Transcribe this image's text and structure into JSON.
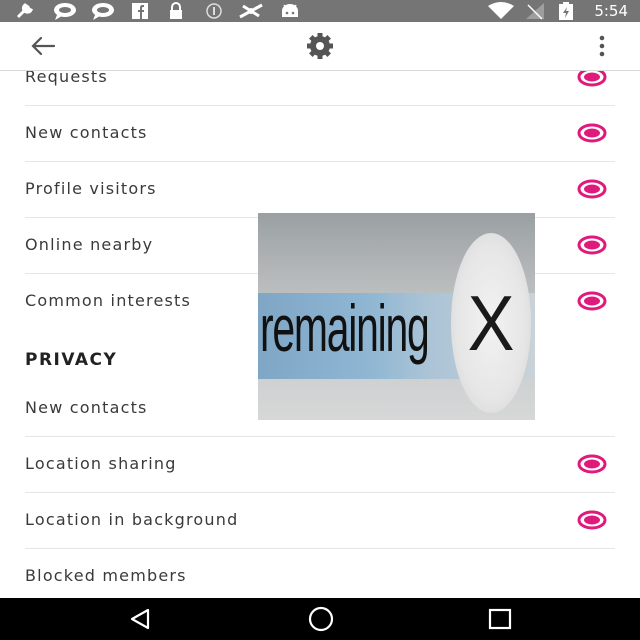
{
  "status_bar": {
    "time": "5:54",
    "icons": [
      "wrench-icon",
      "chat-bubble-icon",
      "chat-bubble-icon",
      "facebook-icon",
      "lock-icon",
      "circle-info-icon",
      "satellite-icon",
      "android-icon",
      "wifi-icon",
      "no-signal-icon",
      "battery-charging-icon"
    ]
  },
  "app_bar": {
    "back_icon": "arrow-left-icon",
    "center_icon": "gear-icon",
    "menu_icon": "overflow-menu-icon"
  },
  "settings": {
    "notifications": [
      {
        "label": "Requests",
        "enabled": true
      },
      {
        "label": "New contacts",
        "enabled": true
      },
      {
        "label": "Profile visitors",
        "enabled": true
      },
      {
        "label": "Online nearby",
        "enabled": true
      },
      {
        "label": "Common interests",
        "enabled": true
      }
    ],
    "privacy_header": "PRIVACY",
    "privacy": [
      {
        "label": "New contacts"
      },
      {
        "label": "Location sharing",
        "enabled": true
      },
      {
        "label": "Location in background",
        "enabled": true
      },
      {
        "label": "Blocked members"
      }
    ]
  },
  "ad_overlay": {
    "text": "remaining",
    "close_glyph": "X"
  },
  "nav_bar": {
    "icons": [
      "back-triangle-icon",
      "home-circle-icon",
      "recents-square-icon"
    ]
  },
  "colors": {
    "accent": "#e0197d",
    "status_bar": "#757575",
    "nav_bar": "#000000"
  }
}
